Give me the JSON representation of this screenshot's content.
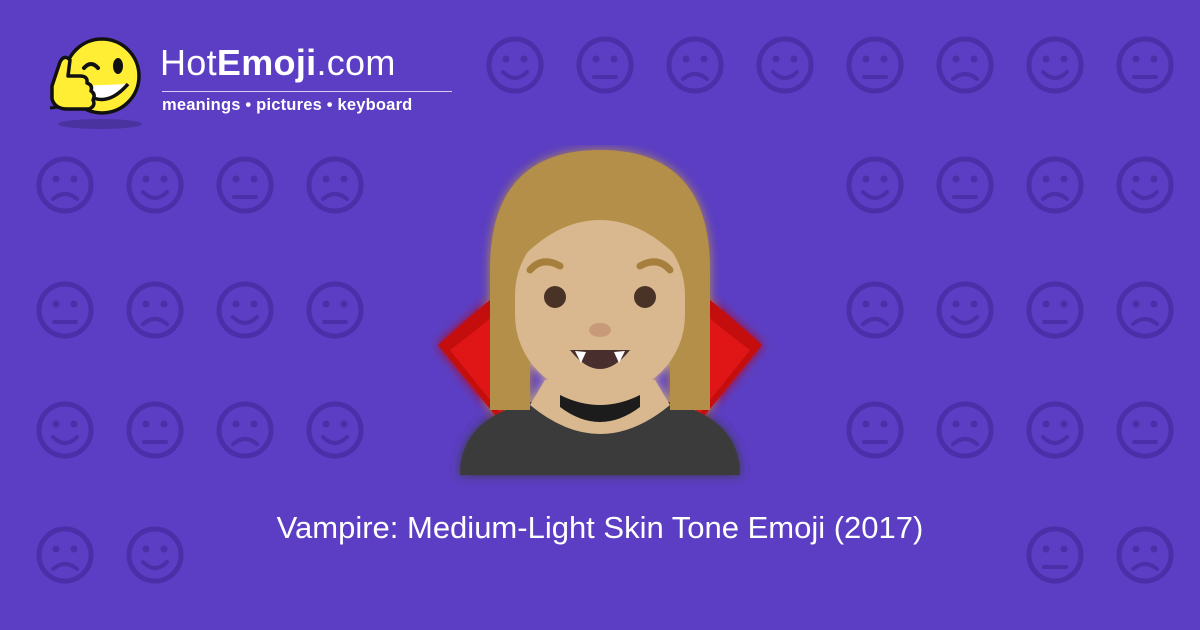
{
  "site": {
    "name_prefix": "Hot",
    "name_bold": "Emoji",
    "name_suffix": ".com",
    "tagline": "meanings • pictures • keyboard"
  },
  "emoji": {
    "caption": "Vampire: Medium-Light Skin Tone Emoji (2017)"
  },
  "colors": {
    "background": "#5b3ec3",
    "pattern": "#4a2fa8",
    "hair": "#b38f4a",
    "skin": "#d9b88f",
    "cape_red": "#d81414",
    "clothing": "#3b3b3b"
  },
  "icons": {
    "logo": "winking-thumbs-up-face-icon",
    "hero": "woman-vampire-medium-light-skin-tone-icon"
  }
}
